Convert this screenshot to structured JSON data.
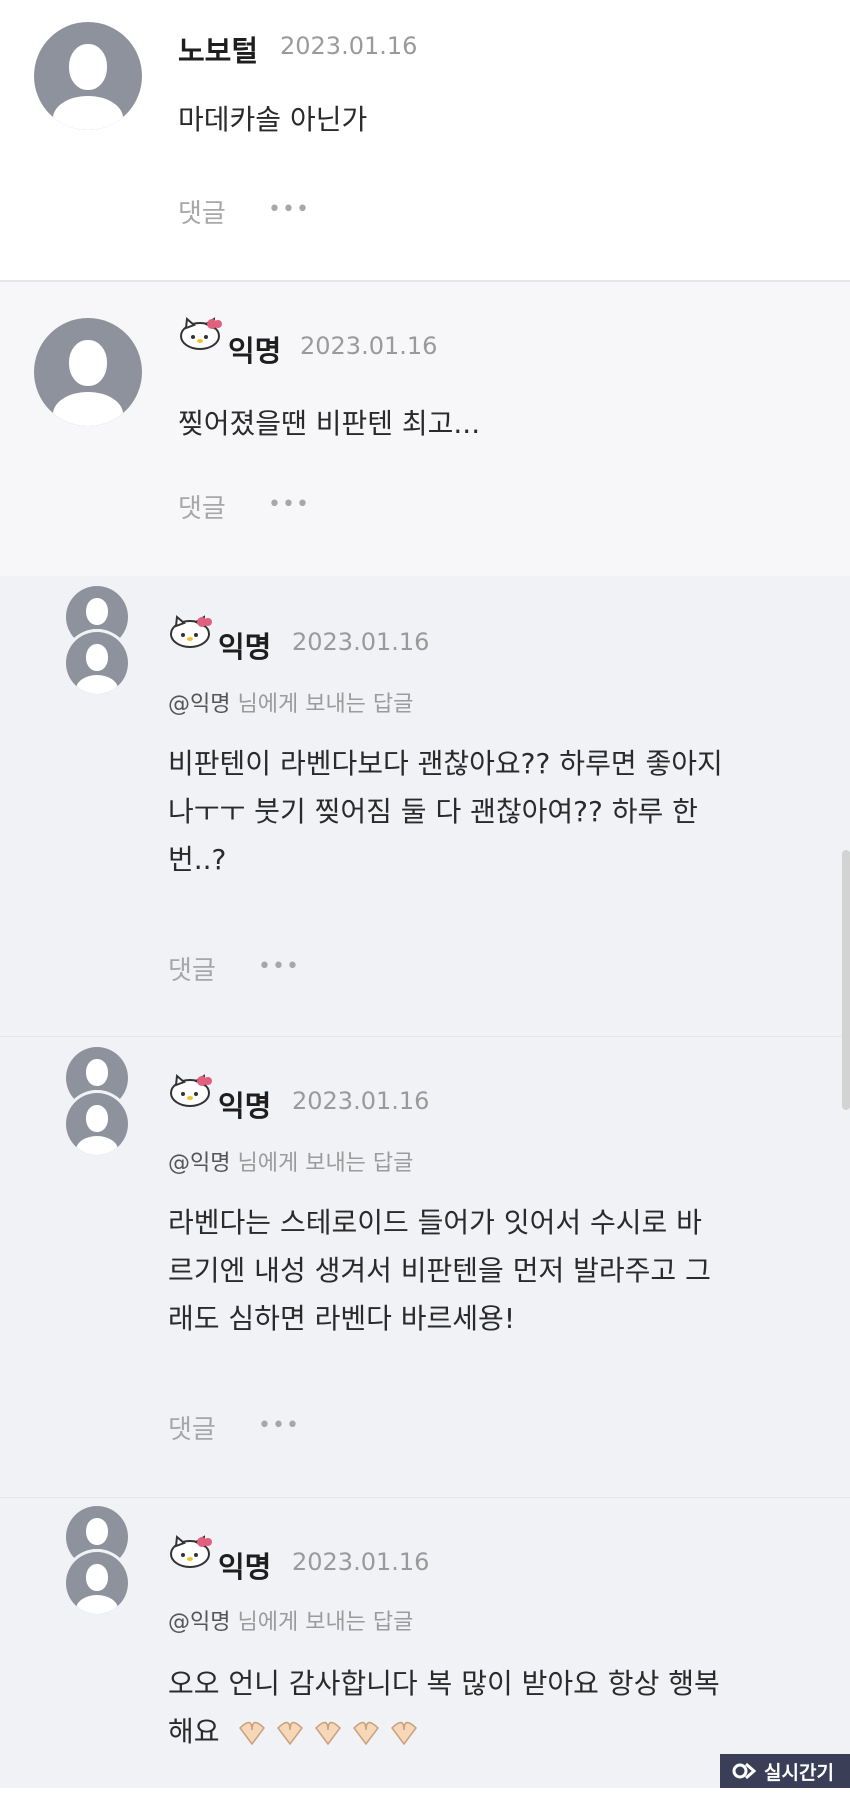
{
  "comments": [
    {
      "author": "노보털",
      "date": "2023.01.16",
      "text": "마데카솔 아닌가",
      "reply_label": "댓글",
      "more_label": "•••"
    },
    {
      "author": "익명",
      "date": "2023.01.16",
      "text": "찢어졌을땐 비판텐 최고...",
      "reply_label": "댓글",
      "more_label": "•••"
    },
    {
      "author": "익명",
      "date": "2023.01.16",
      "mention": "@익명",
      "reply_to_suffix": "님에게 보내는 답글",
      "lines": [
        "비판텐이 라벤다보다 괜찮아요?? 하루면 좋아지",
        "나ㅜㅜ 붓기 찢어짐 둘 다 괜찮아여?? 하루 한",
        "번..?"
      ],
      "reply_label": "댓글",
      "more_label": "•••"
    },
    {
      "author": "익명",
      "date": "2023.01.16",
      "mention": "@익명",
      "reply_to_suffix": "님에게 보내는 답글",
      "lines": [
        "라벤다는 스테로이드 들어가 잇어서 수시로 바",
        "르기엔 내성 생겨서 비판텐을 먼저 발라주고 그",
        "래도 심하면 라벤다 바르세용!"
      ],
      "reply_label": "댓글",
      "more_label": "•••"
    },
    {
      "author": "익명",
      "date": "2023.01.16",
      "mention": "@익명",
      "reply_to_suffix": "님에게 보내는 답글",
      "lines": [
        "오오 언니 감사합니다 복 많이 받아요 항상 행복",
        "해요"
      ]
    }
  ],
  "watermark": {
    "text": "실시간기자"
  },
  "colors": {
    "avatar": "#8e929c",
    "reply_bg": "#f1f2f6",
    "muted": "#a7a7a7"
  }
}
